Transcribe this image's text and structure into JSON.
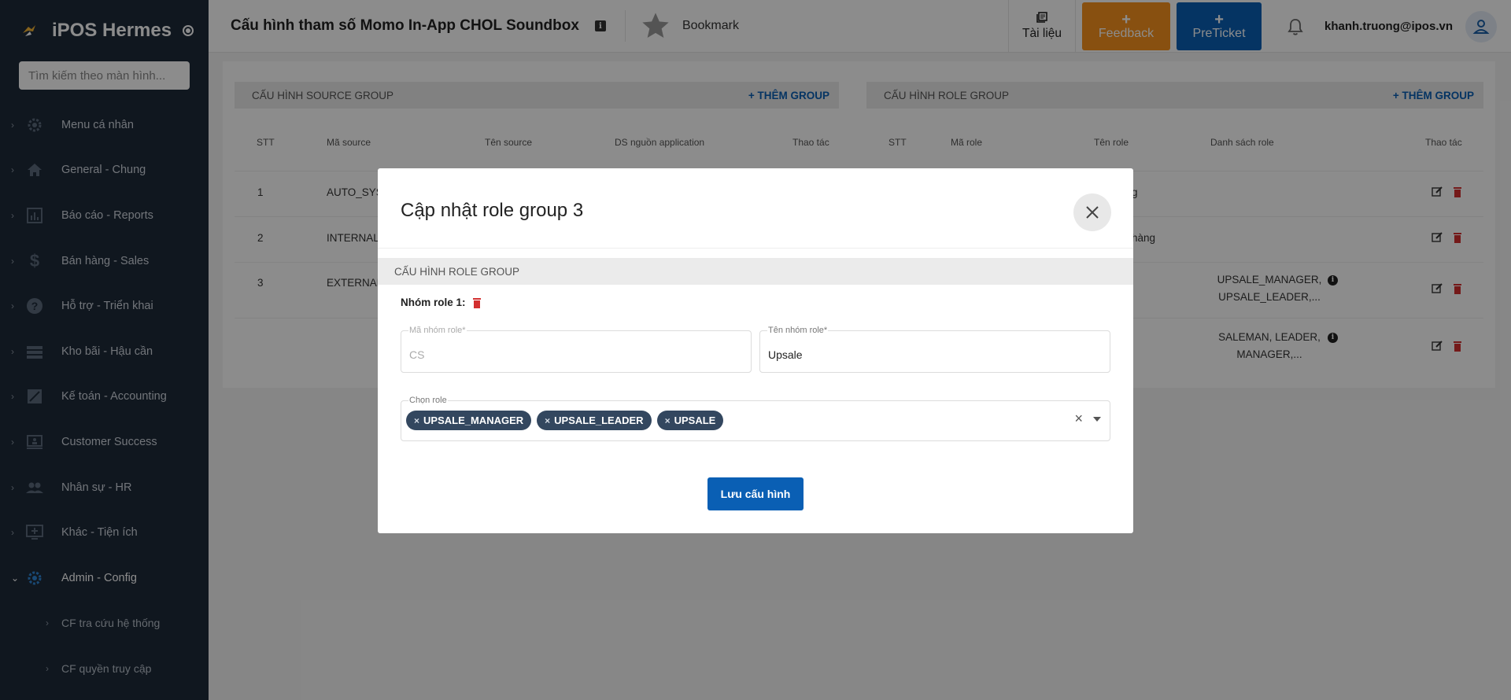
{
  "app": {
    "name": "iPOS Hermes"
  },
  "sidebar": {
    "search_placeholder": "Tìm kiếm theo màn hình...",
    "items": [
      {
        "label": "Menu cá nhân",
        "icon": "gear-icon"
      },
      {
        "label": "General - Chung",
        "icon": "home-icon"
      },
      {
        "label": "Báo cáo - Reports",
        "icon": "bar-chart-icon"
      },
      {
        "label": "Bán hàng - Sales",
        "icon": "dollar-icon"
      },
      {
        "label": "Hỗ trợ - Triển khai",
        "icon": "help-icon"
      },
      {
        "label": "Kho bãi - Hậu cần",
        "icon": "list-icon"
      },
      {
        "label": "Kế toán - Accounting",
        "icon": "accounting-icon"
      },
      {
        "label": "Customer Success",
        "icon": "presentation-icon"
      },
      {
        "label": "Nhân sự - HR",
        "icon": "people-icon"
      },
      {
        "label": "Khác - Tiện ích",
        "icon": "monitor-add-icon"
      },
      {
        "label": "Admin - Config",
        "icon": "gear-icon"
      }
    ],
    "subitems": [
      {
        "label": "CF tra cứu hệ thống"
      },
      {
        "label": "CF quyền truy cập"
      }
    ]
  },
  "header": {
    "title": "Cấu hình tham số Momo In-App CHOL Soundbox",
    "bookmark": "Bookmark",
    "docs": "Tài liệu",
    "feedback": "Feedback",
    "preticket": "PreTicket",
    "user_email": "khanh.truong@ipos.vn"
  },
  "content": {
    "source_panel": {
      "title": "CẤU HÌNH SOURCE GROUP",
      "add": "+ THÊM GROUP"
    },
    "role_panel": {
      "title": "CẤU HÌNH ROLE GROUP",
      "add": "+ THÊM GROUP"
    },
    "source_headers": [
      "STT",
      "Mã source",
      "Tên source",
      "DS nguồn application",
      "Thao tác"
    ],
    "role_headers": [
      "STT",
      "Mã role",
      "Tên role",
      "Danh sách role",
      "Thao tác"
    ],
    "source_rows": [
      {
        "stt": "1",
        "code": "AUTO_SYS"
      },
      {
        "stt": "2",
        "code": "INTERNAL"
      },
      {
        "stt": "3",
        "code": "EXTERNAL"
      }
    ],
    "role_rows": [
      {
        "name_tail": "g",
        "roles_l1": "",
        "roles_l2": ""
      },
      {
        "name_tail": "hàng",
        "roles_l1": "",
        "roles_l2": ""
      },
      {
        "name_tail": "",
        "roles_l1": "UPSALE_MANAGER,",
        "roles_l2": "UPSALE_LEADER,..."
      },
      {
        "name_tail": "",
        "roles_l1": "SALEMAN, LEADER,",
        "roles_l2": "MANAGER,..."
      }
    ]
  },
  "modal": {
    "title": "Cập nhật role group 3",
    "section": "CẤU HÌNH ROLE GROUP",
    "group_label": "Nhóm role 1:",
    "code_label": "Mã nhóm role*",
    "code_value": "CS",
    "name_label": "Tên nhóm role*",
    "name_value": "Upsale",
    "select_label": "Chọn role",
    "chips": [
      "UPSALE_MANAGER",
      "UPSALE_LEADER",
      "UPSALE"
    ],
    "save": "Lưu cấu hình"
  }
}
